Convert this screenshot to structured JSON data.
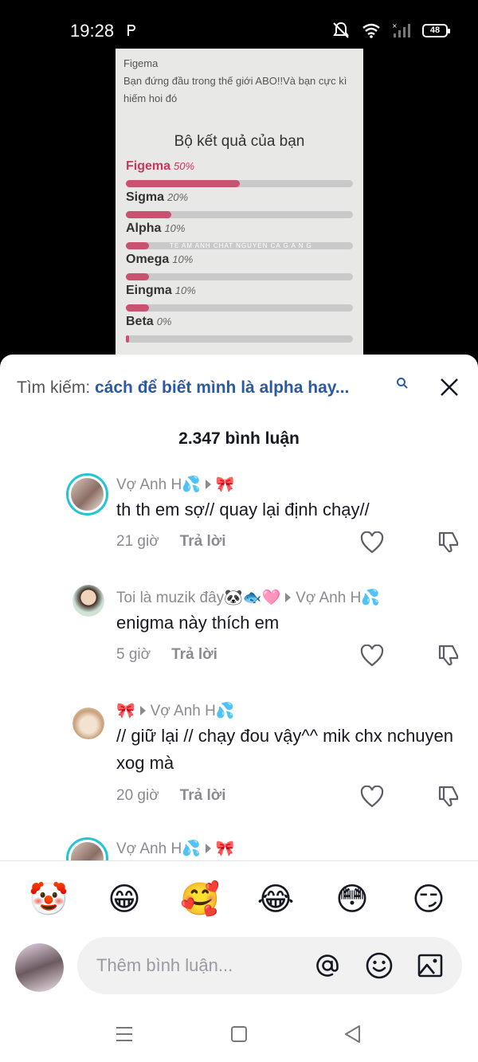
{
  "status_bar": {
    "time": "19:28",
    "battery": "48"
  },
  "video": {
    "header_name": "Figema",
    "header_text": "Bạn đứng đầu trong thế giới ABO!!Và bạn cực kì hiếm hoi đó",
    "results_title": "Bộ kết quả của bạn",
    "watermark": "TE AM ANH CHAT NGUYEN CA G A N G",
    "results": [
      {
        "label": "Figema",
        "pct": "50%",
        "value": 0.5
      },
      {
        "label": "Sigma",
        "pct": "20%",
        "value": 0.2
      },
      {
        "label": "Alpha",
        "pct": "10%",
        "value": 0.1
      },
      {
        "label": "Omega",
        "pct": "10%",
        "value": 0.1
      },
      {
        "label": "Eingma",
        "pct": "10%",
        "value": 0.1
      },
      {
        "label": "Beta",
        "pct": "0%",
        "value": 0.0
      }
    ]
  },
  "sheet": {
    "search_prefix": "Tìm kiếm:",
    "search_query": "cách để biết mình là alpha hay...",
    "comment_count": "2.347 bình luận",
    "comments": [
      {
        "user": "Vợ Anh H💦",
        "reply_to": "🎀",
        "text": "th th em sợ// quay lại định chạy//",
        "time": "21 giờ",
        "reply": "Trả lời"
      },
      {
        "user": "Toi là muzik đây🐼🐟🩷",
        "reply_to": "Vợ Anh H💦",
        "text": "enigma này thích em",
        "time": "5 giờ",
        "reply": "Trả lời"
      },
      {
        "user": "🎀",
        "reply_to": "Vợ Anh H💦",
        "text": "// giữ lại // chạy đou vậy^^ mik chx nchuyen xog mà",
        "time": "20 giờ",
        "reply": "Trả lời"
      },
      {
        "user": "Vợ Anh H💦",
        "reply_to": "🎀",
        "text": "",
        "time": "",
        "reply": ""
      }
    ],
    "emojis": [
      "🤡",
      "😁",
      "🥰",
      "😂",
      "😳",
      "😏"
    ],
    "input_placeholder": "Thêm bình luận..."
  },
  "colors": {
    "accent_blue": "#2c5aa0",
    "ring": "#20c5d6",
    "bar_fill": "#c85270"
  }
}
